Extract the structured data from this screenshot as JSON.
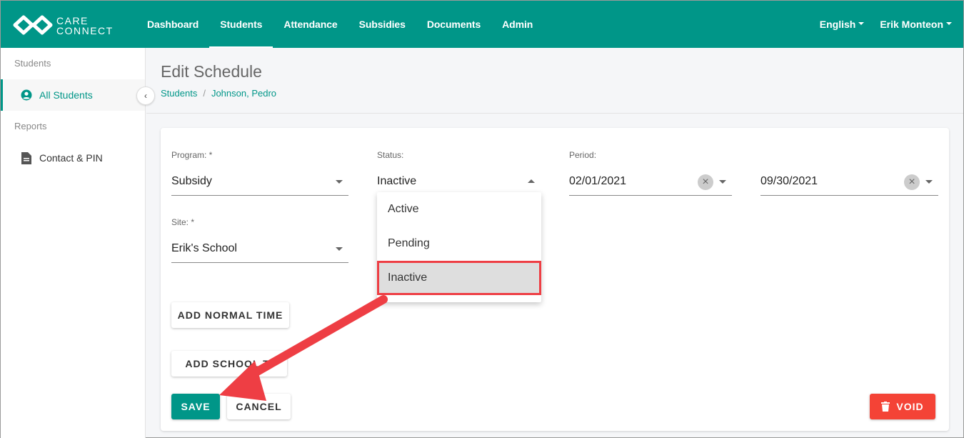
{
  "brand": {
    "line1": "CARE",
    "line2": "CONNECT",
    "color": "#009688"
  },
  "nav": {
    "items": [
      {
        "label": "Dashboard",
        "active": false
      },
      {
        "label": "Students",
        "active": true
      },
      {
        "label": "Attendance",
        "active": false
      },
      {
        "label": "Subsidies",
        "active": false
      },
      {
        "label": "Documents",
        "active": false
      },
      {
        "label": "Admin",
        "active": false
      }
    ],
    "language": "English",
    "user": "Erik Monteon"
  },
  "sidebar": {
    "sections": [
      {
        "heading": "Students",
        "items": [
          {
            "label": "All Students",
            "icon": "user-circle-icon",
            "active": true
          }
        ]
      },
      {
        "heading": "Reports",
        "items": [
          {
            "label": "Contact & PIN",
            "icon": "document-icon",
            "active": false
          }
        ]
      }
    ]
  },
  "header": {
    "title": "Edit Schedule",
    "breadcrumb": [
      "Students",
      "Johnson, Pedro"
    ],
    "breadcrumb_sep": "/"
  },
  "form": {
    "program": {
      "label": "Program: *",
      "value": "Subsidy"
    },
    "status": {
      "label": "Status:",
      "value": "Inactive",
      "options": [
        "Active",
        "Pending",
        "Inactive"
      ],
      "selected": "Inactive"
    },
    "period": {
      "label": "Period:",
      "start": "02/01/2021",
      "end": "09/30/2021"
    },
    "site": {
      "label": "Site: *",
      "value": "Erik's School"
    },
    "clear_glyph": "×"
  },
  "buttons": {
    "add_normal": "ADD NORMAL TIME",
    "add_school": "ADD SCHOOL TI",
    "save": "SAVE",
    "cancel": "CANCEL",
    "void": "VOID"
  },
  "colors": {
    "accent": "#009688",
    "danger": "#f44336",
    "annotation": "#ee3e44"
  }
}
